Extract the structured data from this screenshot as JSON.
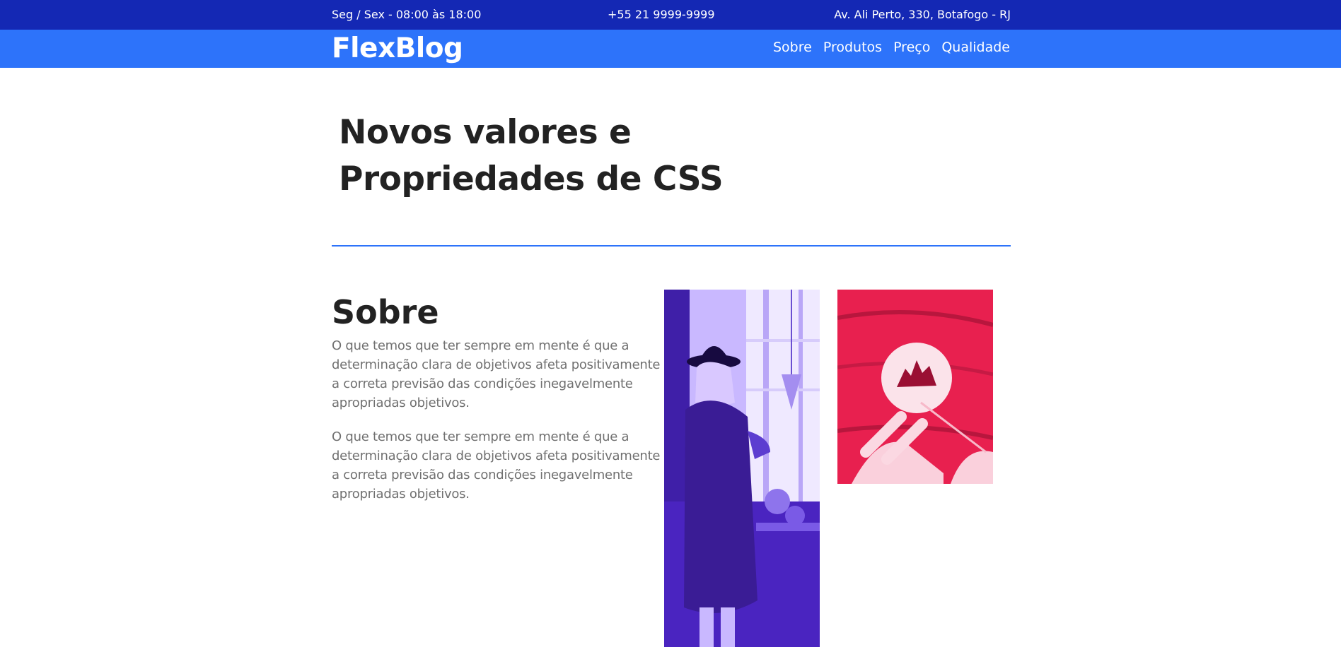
{
  "topbar": {
    "hours": "Seg / Sex - 08:00 às 18:00",
    "phone": "+55 21 9999-9999",
    "address": "Av. Ali Perto, 330, Botafogo - RJ"
  },
  "navbar": {
    "logo": "FlexBlog",
    "links": [
      "Sobre",
      "Produtos",
      "Preço",
      "Qualidade"
    ]
  },
  "hero": {
    "title": "Novos valores e Propriedades de CSS"
  },
  "about": {
    "title": "Sobre",
    "paragraphs": [
      "O que temos que ter sempre em mente é que a determinação clara de objetivos afeta positivamente a correta previsão das condições inegavelmente apropriadas objetivos.",
      "O que temos que ter sempre em mente é que a determinação clara de objetivos afeta positivamente a correta previsão das condições inegavelmente apropriadas objetivos."
    ]
  },
  "colors": {
    "topbar": "#1428b4",
    "navbar": "#2d73fa",
    "accent_line": "#2d73fa",
    "heading": "#222222",
    "body_text": "#707070",
    "photo1_tint": "#6a3ff0",
    "photo2_tint": "#e8204f"
  },
  "images": [
    {
      "icon": "photo-woman-hat-purple"
    },
    {
      "icon": "photo-hands-painting-red"
    }
  ]
}
